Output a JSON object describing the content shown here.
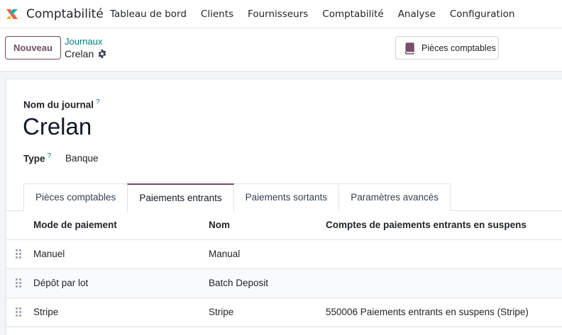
{
  "app": {
    "name": "Comptabilité"
  },
  "menu": [
    {
      "label": "Tableau de bord"
    },
    {
      "label": "Clients"
    },
    {
      "label": "Fournisseurs"
    },
    {
      "label": "Comptabilité"
    },
    {
      "label": "Analyse"
    },
    {
      "label": "Configuration"
    }
  ],
  "control": {
    "new_button": "Nouveau",
    "breadcrumb_parent": "Journaux",
    "breadcrumb_current": "Crelan",
    "smart_button": "Pièces comptables"
  },
  "form": {
    "name_label": "Nom du journal",
    "name_value": "Crelan",
    "type_label": "Type",
    "type_value": "Banque",
    "help_mark": "?"
  },
  "tabs": [
    {
      "label": "Pièces comptables",
      "active": false
    },
    {
      "label": "Paiements entrants",
      "active": true
    },
    {
      "label": "Paiements sortants",
      "active": false
    },
    {
      "label": "Paramètres avancés",
      "active": false
    }
  ],
  "table": {
    "columns": [
      "Mode de paiement",
      "Nom",
      "Comptes de paiements entrants en suspens"
    ],
    "rows": [
      [
        "Manuel",
        "Manual",
        ""
      ],
      [
        "Dépôt par lot",
        "Batch Deposit",
        ""
      ],
      [
        "Stripe",
        "Stripe",
        "550006 Paiements entrants en suspens (Stripe)"
      ]
    ]
  },
  "colors": {
    "brand": "#714B67",
    "link": "#017e84"
  }
}
